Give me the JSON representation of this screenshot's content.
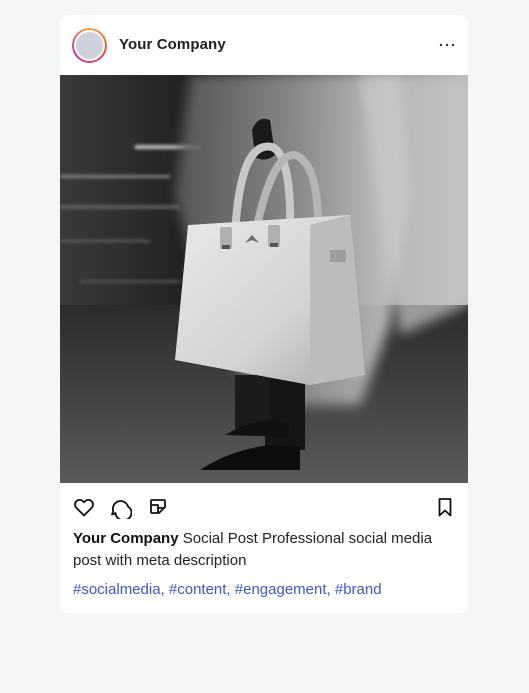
{
  "post": {
    "account_name": "Your Company",
    "more_icon": "more-horizontal-icon",
    "image_alt_subject": "handbag-photo",
    "actions": {
      "like_icon": "heart-icon",
      "comment_icon": "comment-icon",
      "share_icon": "share-icon",
      "save_icon": "bookmark-icon"
    },
    "caption": {
      "username": "Your Company",
      "text": "Social Post Professional social media post with meta description"
    },
    "hashtags": [
      "#socialmedia,",
      "#content,",
      "#engagement,",
      "#brand"
    ]
  },
  "colors": {
    "background": "#f5f6f8",
    "card": "#ffffff",
    "hashtag": "#3b57c9",
    "avatar_ring": [
      "#f6a13a",
      "#e8474e",
      "#b43bb8"
    ]
  }
}
